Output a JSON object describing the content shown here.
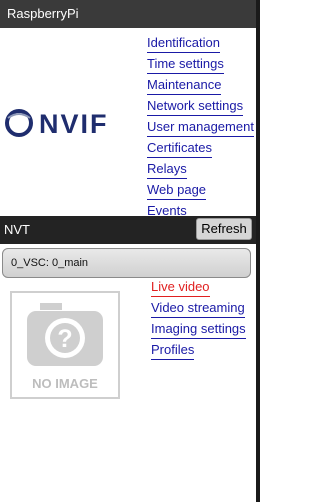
{
  "window": {
    "title": "RaspberryPi"
  },
  "logo": {
    "text": "Onvif"
  },
  "menu": {
    "items": [
      {
        "label": "Identification"
      },
      {
        "label": "Time settings"
      },
      {
        "label": "Maintenance"
      },
      {
        "label": "Network settings"
      },
      {
        "label": "User management"
      },
      {
        "label": "Certificates"
      },
      {
        "label": "Relays"
      },
      {
        "label": "Web page"
      },
      {
        "label": "Events"
      }
    ]
  },
  "nvt": {
    "title": "NVT",
    "refresh_label": "Refresh"
  },
  "profile": {
    "label": "0_VSC: 0_main"
  },
  "preview": {
    "placeholder_text": "NO IMAGE"
  },
  "actions": {
    "items": [
      {
        "label": "Live video",
        "active": true
      },
      {
        "label": "Video streaming"
      },
      {
        "label": "Imaging settings"
      },
      {
        "label": "Profiles"
      }
    ]
  },
  "colors": {
    "link": "#1a1aa6",
    "active_link": "#e02020",
    "logo_blue": "#1f2d6e",
    "titlebar": "#3a3a3a"
  }
}
